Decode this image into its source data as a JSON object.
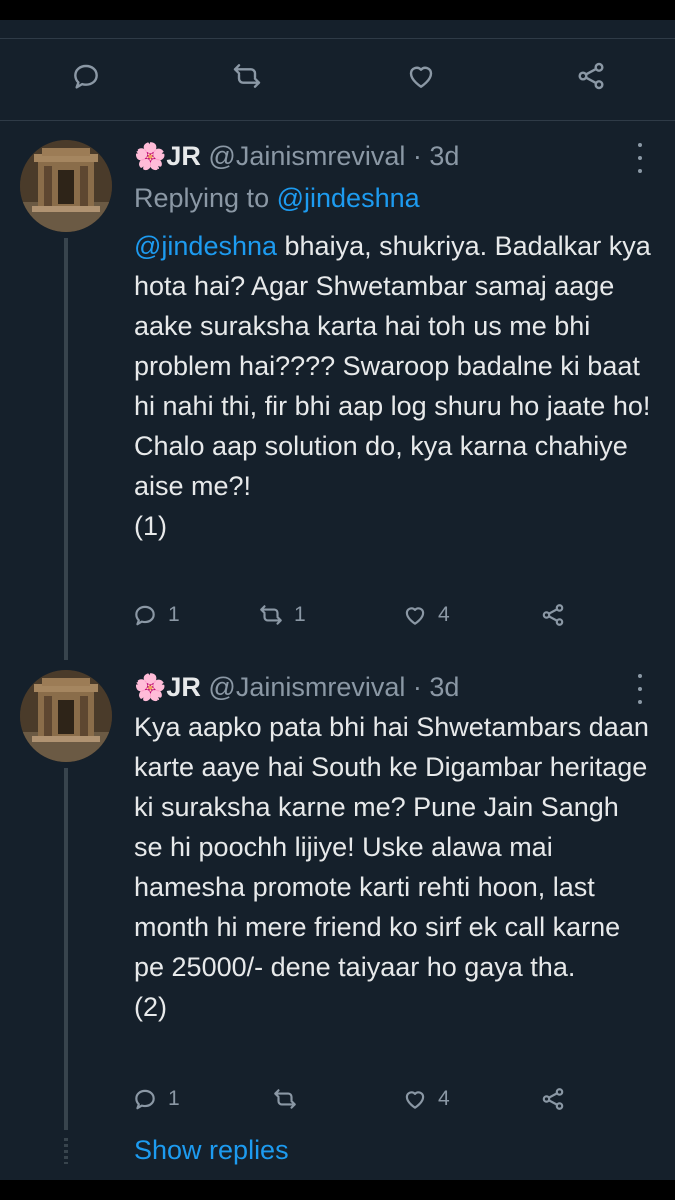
{
  "colors": {
    "background": "#15202b",
    "link": "#1d9bf0",
    "muted": "#8b98a5",
    "text": "#e7e9ea"
  },
  "top_actions": [
    {
      "icon": "reply-icon"
    },
    {
      "icon": "retweet-icon"
    },
    {
      "icon": "like-icon"
    },
    {
      "icon": "share-icon"
    }
  ],
  "tweets": [
    {
      "flower": "🌸",
      "name": "JR",
      "handle": "@Jainismrevival",
      "sep": "·",
      "time": "3d",
      "replying_prefix": "Replying to",
      "replying_handle": "@jindeshna",
      "mention": "@jindeshna",
      "text": " bhaiya, shukriya. Badalkar kya hota hai? Agar Shwetambar samaj aage aake suraksha karta hai toh us me bhi problem hai???? Swaroop badalne ki baat hi nahi thi, fir bhi aap log shuru ho jaate ho! Chalo aap solution do, kya karna chahiye aise me?!",
      "footnote": "(1)",
      "replies": "1",
      "retweets": "1",
      "likes": "4"
    },
    {
      "flower": "🌸",
      "name": "JR",
      "handle": "@Jainismrevival",
      "sep": "·",
      "time": "3d",
      "text": "Kya aapko pata bhi hai Shwetambars daan karte aaye hai South ke Digambar heritage ki suraksha karne me? Pune Jain Sangh se hi poochh lijiye! Uske alawa mai hamesha promote karti rehti hoon, last month hi mere friend ko sirf ek call karne pe 25000/- dene taiyaar ho gaya tha.",
      "footnote": "(2)",
      "replies": "1",
      "retweets": "",
      "likes": "4"
    }
  ],
  "show_replies": "Show replies"
}
